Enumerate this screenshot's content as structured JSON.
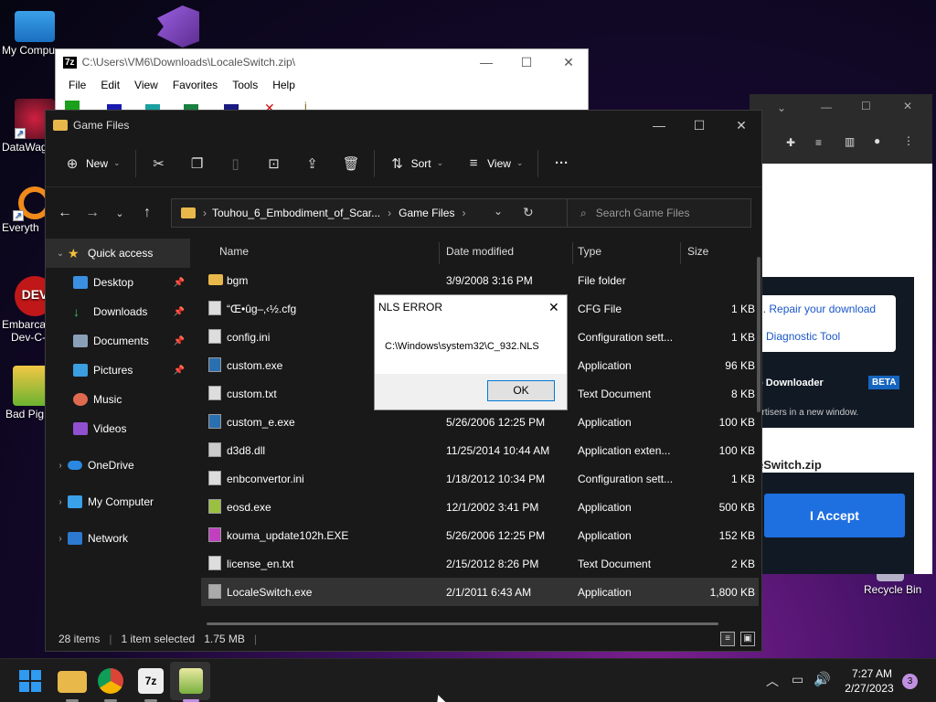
{
  "desktop": {
    "icons": [
      {
        "label": "My Compu"
      },
      {
        "label": "DataWag"
      },
      {
        "label": "Everyth"
      },
      {
        "label": "Embarca"
      },
      {
        "label": "Dev-C-"
      },
      {
        "label": "Bad Pig"
      },
      {
        "label": "Recycle Bin"
      }
    ]
  },
  "sevenzip": {
    "logo": "7z",
    "title": "C:\\Users\\VM6\\Downloads\\LocaleSwitch.zip\\",
    "menu": [
      "File",
      "Edit",
      "View",
      "Favorites",
      "Tools",
      "Help"
    ]
  },
  "browser": {
    "repair_prefix": "d.",
    "repair_link": "Repair your download",
    "diag_link": "d Diagnostic Tool",
    "downloader": "o Downloader",
    "beta": "BETA",
    "advert": "ertisers in a new window.",
    "filename": "eSwitch.zip",
    "accept": "I Accept"
  },
  "explorer": {
    "title": "Game Files",
    "cmd": {
      "new": "New",
      "sort": "Sort",
      "view": "View"
    },
    "address": {
      "crumb1": "Touhou_6_Embodiment_of_Scar...",
      "crumb2": "Game Files"
    },
    "search_placeholder": "Search Game Files",
    "nav": {
      "quick": "Quick access",
      "desktop": "Desktop",
      "downloads": "Downloads",
      "documents": "Documents",
      "pictures": "Pictures",
      "music": "Music",
      "videos": "Videos",
      "onedrive": "OneDrive",
      "mycomputer": "My Computer",
      "network": "Network"
    },
    "columns": {
      "name": "Name",
      "date": "Date modified",
      "type": "Type",
      "size": "Size"
    },
    "files": [
      {
        "name": "bgm",
        "date": "3/9/2008 3:16 PM",
        "type": "File folder",
        "size": ""
      },
      {
        "name": "“Œ•ûg–‚‹½.cfg",
        "date": "",
        "type": "CFG File",
        "size": "1 KB"
      },
      {
        "name": "config.ini",
        "date": "",
        "type": "Configuration sett...",
        "size": "1 KB"
      },
      {
        "name": "custom.exe",
        "date": "",
        "type": "Application",
        "size": "96 KB"
      },
      {
        "name": "custom.txt",
        "date": "",
        "type": "Text Document",
        "size": "8 KB"
      },
      {
        "name": "custom_e.exe",
        "date": "5/26/2006 12:25 PM",
        "type": "Application",
        "size": "100 KB"
      },
      {
        "name": "d3d8.dll",
        "date": "11/25/2014 10:44 AM",
        "type": "Application exten...",
        "size": "100 KB"
      },
      {
        "name": "enbconvertor.ini",
        "date": "1/18/2012 10:34 PM",
        "type": "Configuration sett...",
        "size": "1 KB"
      },
      {
        "name": "eosd.exe",
        "date": "12/1/2002 3:41 PM",
        "type": "Application",
        "size": "500 KB"
      },
      {
        "name": "kouma_update102h.EXE",
        "date": "5/26/2006 12:25 PM",
        "type": "Application",
        "size": "152 KB"
      },
      {
        "name": "license_en.txt",
        "date": "2/15/2012 8:26 PM",
        "type": "Text Document",
        "size": "2 KB"
      },
      {
        "name": "LocaleSwitch.exe",
        "date": "2/1/2011 6:43 AM",
        "type": "Application",
        "size": "1,800 KB"
      }
    ],
    "status": {
      "items": "28 items",
      "selected": "1 item selected",
      "size": "1.75 MB"
    }
  },
  "dialog": {
    "title": "NLS ERROR",
    "message": "C:\\Windows\\system32\\C_932.NLS",
    "ok": "OK"
  },
  "taskbar": {
    "time": "7:27 AM",
    "date": "2/27/2023",
    "notifications": "3",
    "sevenzip_label": "7z"
  }
}
